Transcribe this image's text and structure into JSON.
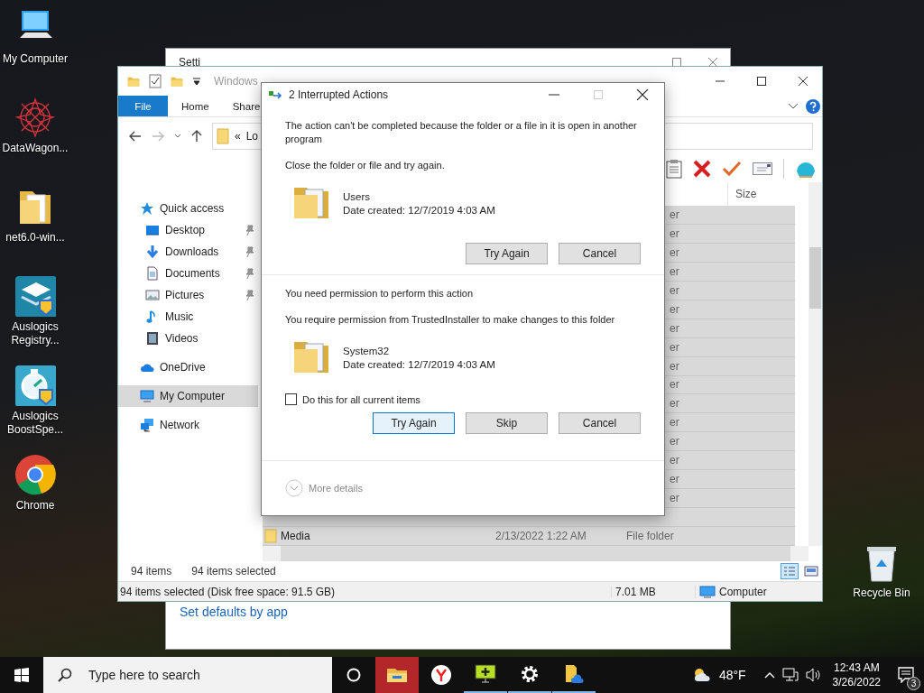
{
  "desktop_icons": [
    {
      "label": "My Computer",
      "kind": "computer"
    },
    {
      "label": "DataWagon...",
      "kind": "starburst"
    },
    {
      "label": "net6.0-win...",
      "kind": "folder"
    },
    {
      "label": "Auslogics Registry...",
      "kind": "registry"
    },
    {
      "label": "Auslogics BoostSpe...",
      "kind": "boost"
    },
    {
      "label": "Chrome",
      "kind": "chrome"
    }
  ],
  "recycle_bin": {
    "label": "Recycle Bin"
  },
  "settings_window": {
    "title": "Setti",
    "link": "Set defaults by app"
  },
  "explorer": {
    "title": "Windows",
    "ribbon_tabs": [
      {
        "label": "File",
        "selected": true
      },
      {
        "label": "Home",
        "selected": false
      },
      {
        "label": "Share",
        "selected": false
      }
    ],
    "address": {
      "chevron": "«",
      "path": "Lo"
    },
    "navigation": [
      {
        "label": "Quick access",
        "kind": "star",
        "selected": false,
        "children": [
          {
            "label": "Desktop",
            "kind": "desktop",
            "pinned": true,
            "selected": false
          },
          {
            "label": "Downloads",
            "kind": "download",
            "pinned": true,
            "selected": false
          },
          {
            "label": "Documents",
            "kind": "document",
            "pinned": true,
            "selected": false
          },
          {
            "label": "Pictures",
            "kind": "picture",
            "pinned": true,
            "selected": false
          },
          {
            "label": "Music",
            "kind": "music",
            "pinned": false,
            "selected": false
          },
          {
            "label": "Videos",
            "kind": "video",
            "pinned": false,
            "selected": false
          }
        ]
      },
      {
        "label": "OneDrive",
        "kind": "cloud",
        "selected": false
      },
      {
        "label": "My Computer",
        "kind": "computer",
        "selected": true
      },
      {
        "label": "Network",
        "kind": "network",
        "selected": false
      }
    ],
    "columns": [
      {
        "label": "Size"
      }
    ],
    "rows": [
      {
        "kind": "covered",
        "type": "er",
        "selected": true
      },
      {
        "kind": "covered",
        "type": "er",
        "selected": true
      },
      {
        "kind": "covered",
        "type": "er",
        "selected": true
      },
      {
        "kind": "covered",
        "type": "er",
        "selected": true
      },
      {
        "kind": "covered",
        "type": "er",
        "selected": true
      },
      {
        "kind": "covered",
        "type": "er",
        "selected": true
      },
      {
        "kind": "covered",
        "type": "er",
        "selected": true
      },
      {
        "kind": "covered",
        "type": "er",
        "selected": true
      },
      {
        "kind": "covered",
        "type": "er",
        "selected": true
      },
      {
        "kind": "covered",
        "type": "er",
        "selected": true
      },
      {
        "kind": "covered",
        "type": "er",
        "selected": true
      },
      {
        "kind": "covered",
        "type": "er",
        "selected": true
      },
      {
        "kind": "covered",
        "type": "er",
        "selected": true
      },
      {
        "kind": "covered",
        "type": "er",
        "selected": true
      },
      {
        "kind": "covered",
        "type": "er",
        "selected": true
      },
      {
        "kind": "covered",
        "type": "er",
        "selected": true
      },
      {
        "kind": "covered",
        "selected": true
      },
      {
        "kind": "full",
        "name": "Media",
        "date": "2/13/2022 1:22 AM",
        "type": "File folder",
        "selected": true
      }
    ],
    "item_count": "94 items",
    "selection_count": "94 items selected",
    "status_bar": {
      "summary": "94 items selected (Disk free space: 91.5 GB)",
      "size": "7.01 MB",
      "location": "Computer"
    }
  },
  "dialog": {
    "title": "2 Interrupted Actions",
    "sections": [
      {
        "kind": "in_use",
        "heading": "The action can't be completed because the folder or a file in it is open in another program",
        "instruction": "Close the folder or file and try again.",
        "item": {
          "name": "Users",
          "date": "Date created: 12/7/2019 4:03 AM"
        },
        "buttons": [
          {
            "label": "Try Again",
            "focused": false
          },
          {
            "label": "Cancel",
            "focused": false
          }
        ]
      },
      {
        "kind": "permission",
        "heading": "You need permission to perform this action",
        "instruction": "You require permission from TrustedInstaller to make changes to this folder",
        "item": {
          "name": "System32",
          "date": "Date created: 12/7/2019 4:03 AM"
        },
        "option": {
          "label": "Do this for all current items",
          "checked": false
        },
        "buttons": [
          {
            "label": "Try Again",
            "focused": true
          },
          {
            "label": "Skip",
            "focused": false
          },
          {
            "label": "Cancel",
            "focused": false
          }
        ]
      }
    ],
    "more_details": "More details"
  },
  "taskbar": {
    "search_placeholder": "Type here to search",
    "apps": [
      {
        "kind": "explorer",
        "active": true,
        "running": false
      },
      {
        "kind": "yandex",
        "active": false,
        "running": false
      },
      {
        "kind": "monitor",
        "active": false,
        "running": true
      },
      {
        "kind": "gear",
        "active": false,
        "running": true
      },
      {
        "kind": "folder_cloud",
        "active": false,
        "running": true
      }
    ],
    "weather": "48°F",
    "time": "12:43 AM",
    "date": "3/26/2022",
    "notifications": "3"
  }
}
